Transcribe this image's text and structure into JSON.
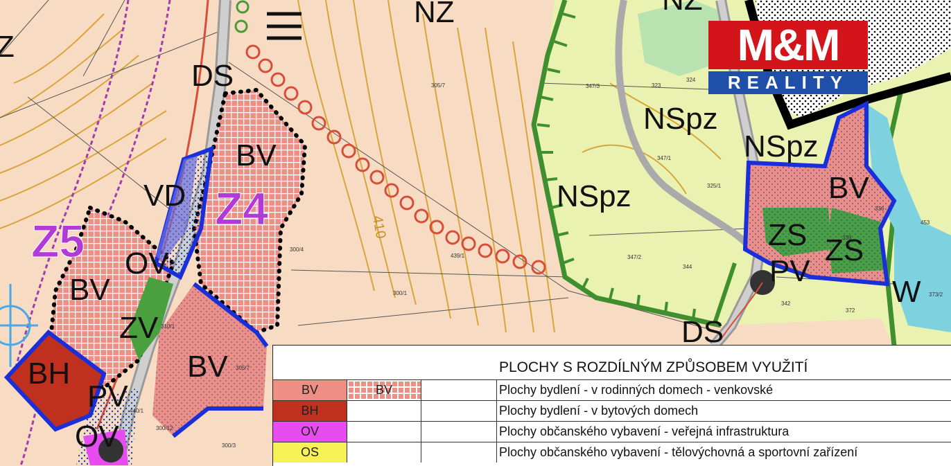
{
  "map": {
    "zone_labels": [
      "Z4",
      "Z5"
    ],
    "area_labels": [
      "NZ",
      "NZ",
      "Z",
      "DS",
      "BV",
      "VD",
      "OV",
      "BV",
      "ZV",
      "BH",
      "PV",
      "OV",
      "BV",
      "NSpz",
      "NSpz",
      "NSpz",
      "BV",
      "ZS",
      "ZS",
      "PV",
      "W",
      "DS"
    ],
    "contour_label": "410",
    "plot_numbers": [
      "305/7",
      "300/4",
      "300/1",
      "439/1",
      "347/3",
      "323",
      "324",
      "347/1",
      "325/1",
      "344",
      "342",
      "372",
      "373/2",
      "453",
      "339",
      "336",
      "347/2",
      "300/12",
      "300/3",
      "305/7",
      "440/1",
      "310/1"
    ]
  },
  "logo": {
    "top": "M&M",
    "bottom": "REALITY",
    "red": "#d3141b",
    "blue": "#1f4fa8"
  },
  "legend": {
    "title": "PLOCHY S ROZDÍLNÝM ZPŮSOBEM VYUŽITÍ",
    "rows": [
      {
        "code": "BV",
        "code2": "BV",
        "color": "#ee8f86",
        "text": "Plochy bydlení - v rodinných domech - venkovské"
      },
      {
        "code": "BH",
        "code2": "",
        "color": "#c0301f",
        "text": "Plochy bydlení - v bytových domech"
      },
      {
        "code": "OV",
        "code2": "",
        "color": "#e64cf0",
        "text": "Plochy občanského vybavení - veřejná infrastruktura"
      },
      {
        "code": "OS",
        "code2": "",
        "color": "#f6f154",
        "text": "Plochy občanského vybavení - tělovýchovná a sportovní zařízení"
      }
    ]
  }
}
